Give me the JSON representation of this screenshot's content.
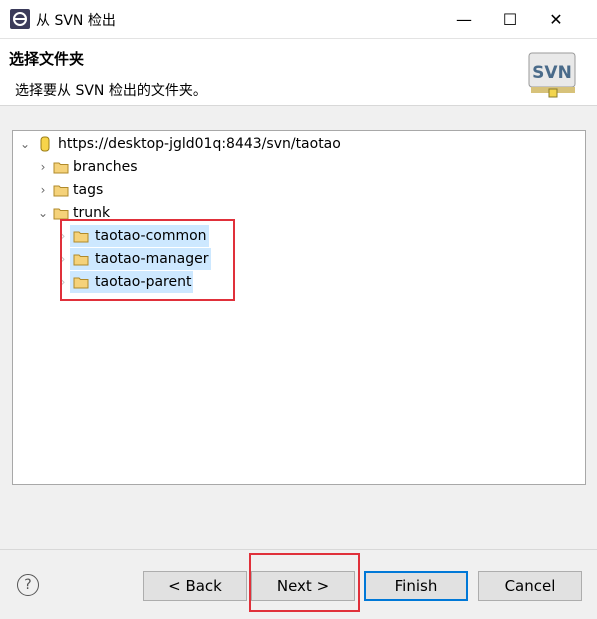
{
  "window": {
    "title": "从 SVN 检出",
    "minimize_glyph": "—",
    "maximize_glyph": "☐",
    "close_glyph": "✕"
  },
  "banner": {
    "title": "选择文件夹",
    "description": "选择要从 SVN 检出的文件夹。",
    "logo_text": "SVN"
  },
  "tree": {
    "root": "https://desktop-jgld01q:8443/svn/taotao",
    "items": [
      {
        "label": "branches",
        "expanded": false
      },
      {
        "label": "tags",
        "expanded": false
      },
      {
        "label": "trunk",
        "expanded": true,
        "children": [
          "taotao-common",
          "taotao-manager",
          "taotao-parent"
        ]
      }
    ]
  },
  "buttons": {
    "help": "?",
    "back": "< Back",
    "next": "Next >",
    "finish": "Finish",
    "cancel": "Cancel"
  },
  "colors": {
    "selection": "#cde8ff",
    "highlight": "#e0303a",
    "default_button_border": "#0078d7"
  }
}
